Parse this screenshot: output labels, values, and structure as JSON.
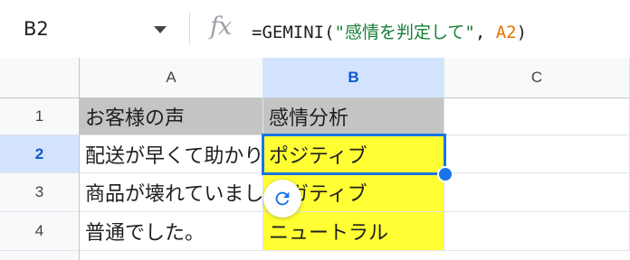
{
  "formula_bar": {
    "name_box": "B2",
    "fx_label": "fx",
    "formula": {
      "prefix": "=GEMINI(",
      "string_arg": "\"感情を判定して\"",
      "separator": ", ",
      "ref_arg": "A2",
      "suffix": ")"
    }
  },
  "columns": [
    {
      "label": "A",
      "selected": false
    },
    {
      "label": "B",
      "selected": true
    },
    {
      "label": "C",
      "selected": false
    }
  ],
  "rows": [
    {
      "label": "1",
      "selected": false,
      "cells": [
        "お客様の声",
        "感情分析",
        ""
      ]
    },
    {
      "label": "2",
      "selected": true,
      "cells": [
        "配送が早くて助かりました",
        "ポジティブ",
        ""
      ]
    },
    {
      "label": "3",
      "selected": false,
      "cells": [
        "商品が壊れていました",
        "ネガティブ",
        ""
      ]
    },
    {
      "label": "4",
      "selected": false,
      "cells": [
        "普通でした。",
        "ニュートラル",
        ""
      ]
    }
  ],
  "colors": {
    "header_fill": "#c4c4c4",
    "result_fill": "#ffff33",
    "selection": "#1a73e8"
  },
  "icons": {
    "refresh": "refresh-icon",
    "dropdown": "chevron-down-icon",
    "fx": "function-icon"
  }
}
